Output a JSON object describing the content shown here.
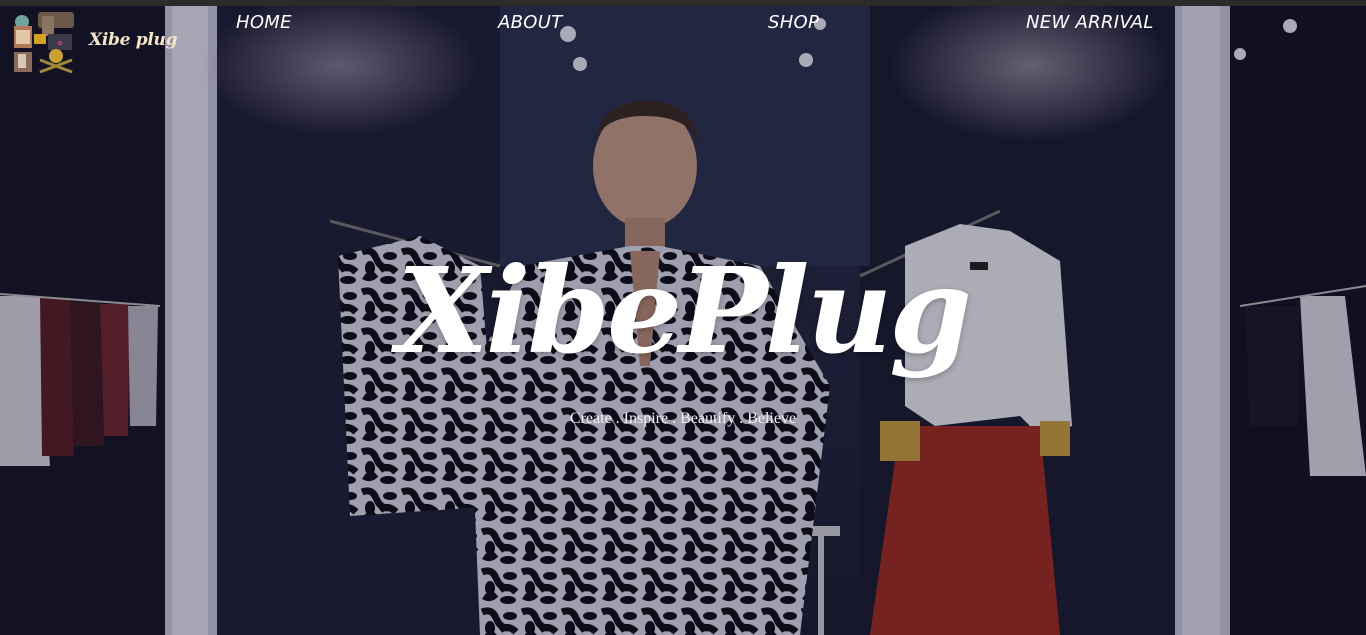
{
  "brand": {
    "logo_text": "Xibe plug",
    "logo_icon": "tailoring-collage-icon"
  },
  "nav": {
    "items": [
      {
        "label": "HOME"
      },
      {
        "label": "ABOUT"
      },
      {
        "label": "SHOP"
      },
      {
        "label": "NEW ARRIVAL"
      }
    ]
  },
  "hero": {
    "title": "XibePlug",
    "tagline": "Create . Inspire . Beautify . Believe",
    "background": "boutique-model-photo"
  },
  "colors": {
    "text": "#ffffff",
    "logo_text": "#f3e4c6",
    "overlay": "#0a0a1e"
  }
}
